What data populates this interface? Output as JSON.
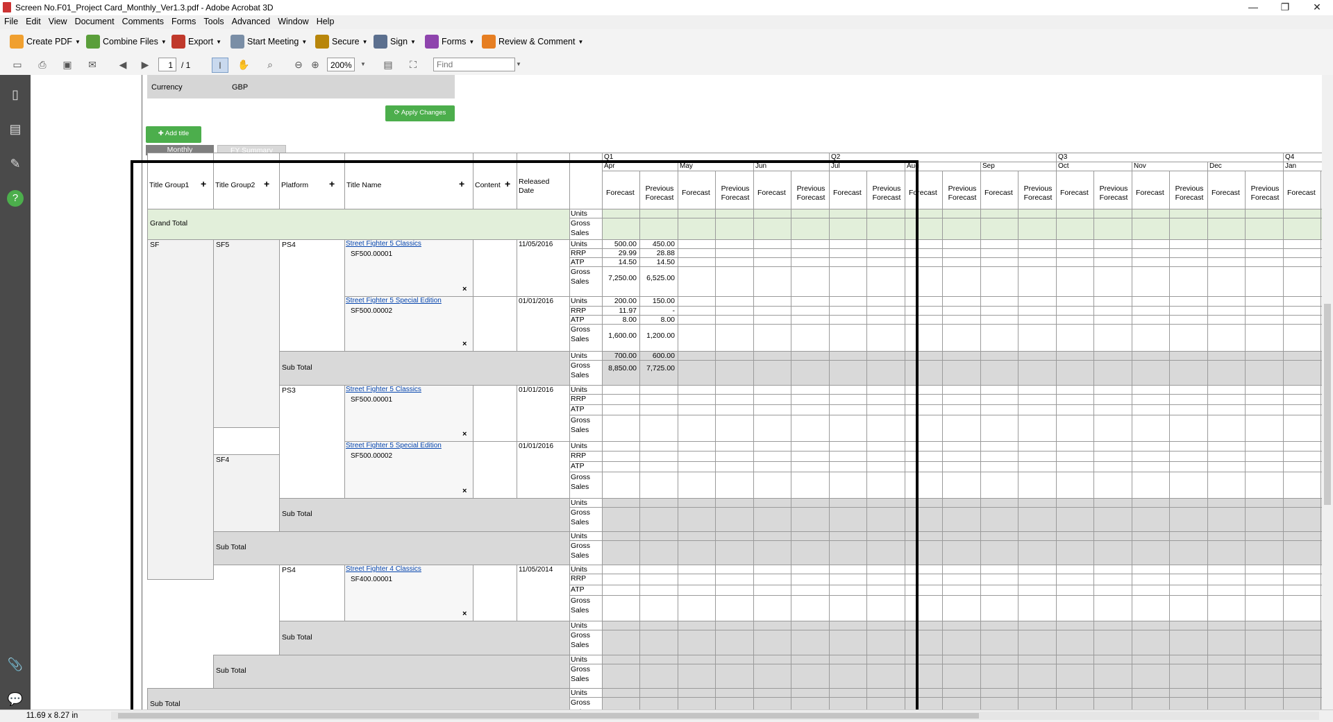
{
  "window": {
    "title": "Screen No.F01_Project Card_Monthly_Ver1.3.pdf - Adobe Acrobat 3D",
    "controls": [
      "—",
      "❐",
      "✕"
    ]
  },
  "menu": [
    "File",
    "Edit",
    "View",
    "Document",
    "Comments",
    "Forms",
    "Tools",
    "Advanced",
    "Window",
    "Help"
  ],
  "toolbar": {
    "create_pdf": "Create PDF",
    "combine_files": "Combine Files",
    "export": "Export",
    "start_meeting": "Start Meeting",
    "secure": "Secure",
    "sign": "Sign",
    "forms": "Forms",
    "review_comment": "Review & Comment"
  },
  "nav": {
    "page_current": "1",
    "page_total": "/ 1",
    "zoom": "200%",
    "find_placeholder": "Find"
  },
  "status": {
    "page_size": "11.69 x 8.27 in"
  },
  "colors": {
    "accent_green": "#4cae4c",
    "grand_total_bg": "#e2efda",
    "subtotal_bg": "#d9d9d9",
    "highlight_border": "#000000"
  },
  "form": {
    "currency_label": "Currency",
    "currency_value": "GBP",
    "apply_changes": "Apply Changes",
    "add_title": "Add title",
    "tab_monthly": "Monthly",
    "tab_fy_summary": "FY Summary"
  },
  "grid": {
    "headers": [
      "Title Group1",
      "Title Group2",
      "Platform",
      "Title Name",
      "Content",
      "Released Date"
    ],
    "add_symbol": "+",
    "quarters": [
      "Q1",
      "Q2",
      "Q3",
      "Q4"
    ],
    "months": [
      "Apr",
      "May",
      "Jun",
      "Jul",
      "Aug",
      "Sep",
      "Oct",
      "Nov",
      "Dec",
      "Jan"
    ],
    "forecast": "Forecast",
    "previous_forecast": "Previous Forecast",
    "measures": {
      "units": "Units",
      "rrp": "RRP",
      "atp": "ATP",
      "gross_sales": "Gross Sales"
    },
    "grand_total": "Grand Total",
    "sub_total": "Sub Total",
    "remove_symbol": "×",
    "groups": [
      {
        "group1": "SF",
        "group2": "SF5",
        "platform": "PS4"
      },
      {
        "group1": "SF",
        "group2": "SF5",
        "platform": "PS3"
      },
      {
        "group1": "SF",
        "group2": "SF4",
        "platform": "PS4"
      }
    ],
    "titles": [
      {
        "name": "Street Fighter 5 Classics",
        "code": "SF500.00001",
        "date": "11/05/2016",
        "apr_forecast": {
          "units": "500.00",
          "rrp": "29.99",
          "atp": "14.50",
          "gross": "7,250.00"
        },
        "apr_previous": {
          "units": "450.00",
          "rrp": "28.88",
          "atp": "14.50",
          "gross": "6,525.00"
        }
      },
      {
        "name": "Street Fighter 5 Special Edition",
        "code": "SF500.00002",
        "date": "01/01/2016",
        "apr_forecast": {
          "units": "200.00",
          "rrp": "11.97",
          "atp": "8.00",
          "gross": "1,600.00"
        },
        "apr_previous": {
          "units": "150.00",
          "rrp": "-",
          "atp": "8.00",
          "gross": "1,200.00"
        }
      },
      {
        "name": "Street Fighter 5 Classics",
        "code": "SF500.00001",
        "date": "01/01/2016"
      },
      {
        "name": "Street Fighter 5 Special Edition",
        "code": "SF500.00002",
        "date": "01/01/2016"
      },
      {
        "name": "Street Fighter 4 Classics",
        "code": "SF400.00001",
        "date": "11/05/2014"
      }
    ],
    "ps4_subtotal": {
      "units_f": "700.00",
      "units_p": "600.00",
      "gross_f": "8,850.00",
      "gross_p": "7,725.00"
    }
  }
}
